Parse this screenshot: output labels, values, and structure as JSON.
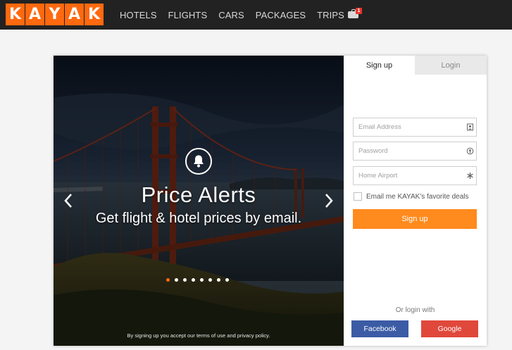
{
  "header": {
    "logo_letters": [
      "K",
      "A",
      "Y",
      "A",
      "K"
    ],
    "nav": [
      {
        "label": "HOTELS"
      },
      {
        "label": "FLIGHTS"
      },
      {
        "label": "CARS"
      },
      {
        "label": "PACKAGES"
      },
      {
        "label": "TRIPS"
      }
    ],
    "trips_badge": "1"
  },
  "hero": {
    "title": "Price Alerts",
    "subtitle": "Get flight & hotel prices by email.",
    "terms": "By signing up you accept our terms of use and privacy policy.",
    "slide_count": 8,
    "active_slide": 1
  },
  "form": {
    "tabs": [
      {
        "label": "Sign up",
        "active": true
      },
      {
        "label": "Login",
        "active": false
      }
    ],
    "email_placeholder": "Email Address",
    "password_placeholder": "Password",
    "airport_placeholder": "Home Airport",
    "checkbox_label": "Email me KAYAK's favorite deals",
    "checkbox_checked": false,
    "signup_label": "Sign up",
    "or_login": "Or login with",
    "facebook_label": "Facebook",
    "google_label": "Google"
  },
  "colors": {
    "brand_orange": "#ff690f",
    "signup_button": "#ff8a1e",
    "facebook": "#3b5ba5",
    "google": "#e0483b",
    "topbar": "#222222"
  }
}
